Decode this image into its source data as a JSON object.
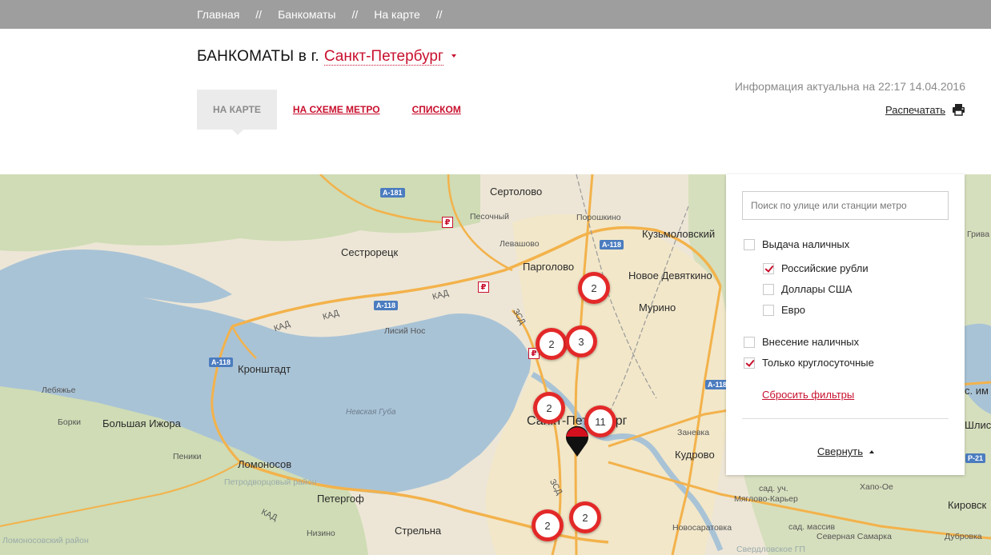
{
  "breadcrumbs": [
    {
      "label": "Главная"
    },
    {
      "label": "Банкоматы"
    },
    {
      "label": "На карте"
    }
  ],
  "breadcrumb_separator": "//",
  "header": {
    "title": "БАНКОМАТЫ в г.",
    "city": "Санкт-Петербург",
    "updated": "Информация актуальна на 22:17 14.04.2016",
    "print_label": "Распечатать"
  },
  "tabs": [
    {
      "label": "На карте",
      "active": true
    },
    {
      "label": "На схеме метро",
      "active": false
    },
    {
      "label": "Списком",
      "active": false
    }
  ],
  "filters": {
    "search_placeholder": "Поиск по улице или станции метро",
    "cash_withdrawal": {
      "label": "Выдача наличных",
      "checked": false
    },
    "rub": {
      "label": "Российские рубли",
      "checked": true
    },
    "usd": {
      "label": "Доллары США",
      "checked": false
    },
    "eur": {
      "label": "Евро",
      "checked": false
    },
    "cash_deposit": {
      "label": "Внесение наличных",
      "checked": false
    },
    "round_clock": {
      "label": "Только круглосуточные",
      "checked": true
    },
    "reset_label": "Сбросить фильтры",
    "collapse_label": "Свернуть"
  },
  "map": {
    "places": {
      "sertolovo": "Сертолово",
      "pesochny": "Песочный",
      "poroshkino": "Порошкино",
      "kuzmolovsky": "Кузьмоловский",
      "levashovo": "Левашово",
      "sestroretsk": "Сестрорецк",
      "pargolovo": "Парголово",
      "novoe_devyatkino": "Новое Девяткино",
      "murino": "Мурино",
      "lisiy_nos": "Лисий Нос",
      "kronshtadt": "Кронштадт",
      "lebyazhye": "Лебяжье",
      "nevskaya_guba": "Невская Губа",
      "spb": "Санкт-Петербург",
      "borki": "Борки",
      "bolshaya_izhora": "Большая Ижора",
      "peniki": "Пеники",
      "lomonosov": "Ломоносов",
      "zanevka": "Заневка",
      "kudrovo": "Кудрово",
      "petrodvortsovy": "Петродворцовый район",
      "petergof": "Петергоф",
      "nizino": "Низино",
      "strelna": "Стрельна",
      "lomonosovsky": "Ломоносовский район",
      "novosaratovka": "Новосаратовка",
      "sad_uch": "сад. уч.",
      "myaglovo": "Мяглово-Карьер",
      "sad_massiv": "сад. массив",
      "severnaya_samarka": "Северная Самарка",
      "khapo_oe": "Хапо-Ое",
      "kirovsk": "Кировск",
      "dubrovka": "Дубровка",
      "sverdlovskoe": "Свердловское ГП",
      "shlis": "Шлис",
      "griva": "Грива",
      "s_im": "с. им"
    },
    "roads": {
      "a181": "А-181",
      "a118_1": "А-118",
      "a118_2": "А-118",
      "a118_3": "А-118",
      "a118_4": "А-118",
      "r21": "Р-21",
      "kad": "КАД",
      "zsd": "ЗСД"
    },
    "clusters": [
      "2",
      "2",
      "3",
      "2",
      "11",
      "2",
      "2"
    ],
    "colors": {
      "accent": "#c8102e",
      "cluster": "#e32828",
      "water": "#a9c3d6",
      "land": "#ede6d6",
      "forest": "#cddcb1"
    }
  }
}
